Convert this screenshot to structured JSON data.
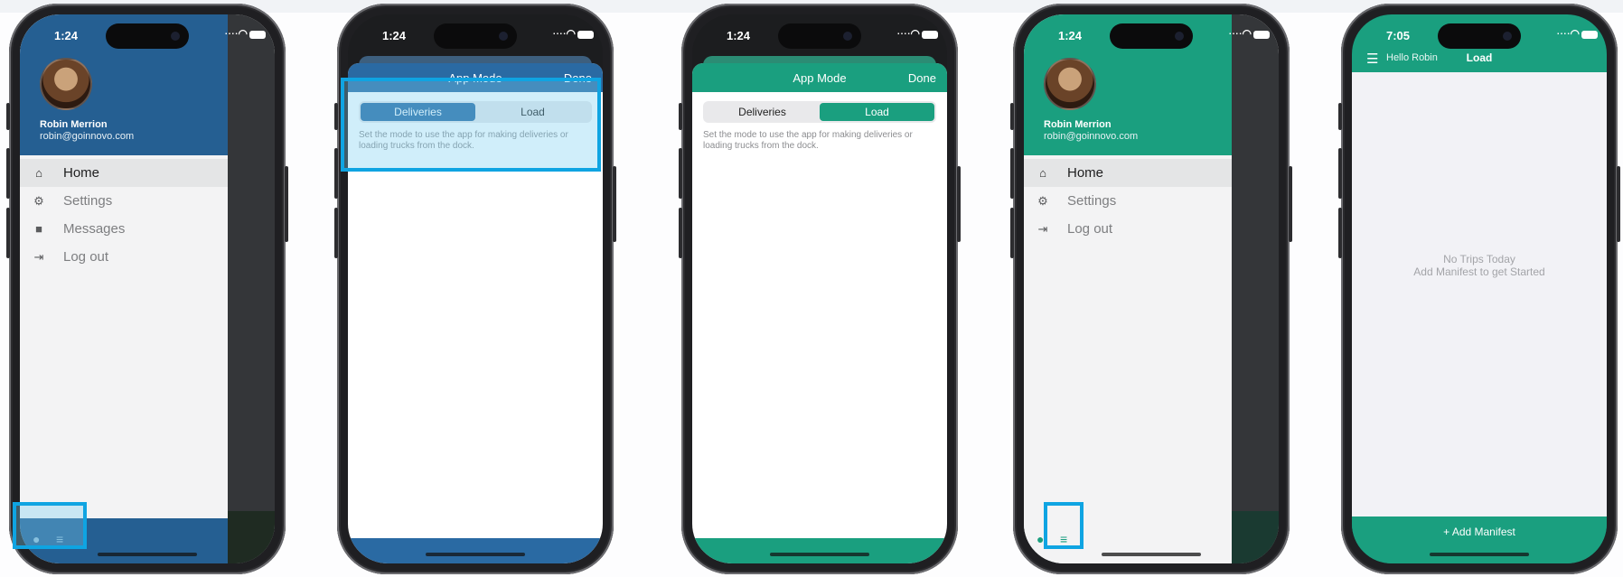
{
  "colors": {
    "blue_header": "#255f92",
    "blue_accent": "#2a6aa3",
    "teal": "#1a9f7f",
    "highlight": "#0fa4e2"
  },
  "phone1": {
    "status_time": "1:24",
    "user_name": "Robin Merrion",
    "user_email": "robin@goinnovo.com",
    "menu": [
      {
        "label": "Home",
        "icon": "home-icon"
      },
      {
        "label": "Settings",
        "icon": "gear-icon"
      },
      {
        "label": "Messages",
        "icon": "chat-bubble-icon"
      },
      {
        "label": "Log out",
        "icon": "logout-icon"
      }
    ],
    "footer_icons": [
      "lightbulb-icon",
      "sliders-icon"
    ]
  },
  "phone2": {
    "status_time": "1:24",
    "title": "App Mode",
    "done": "Done",
    "segments": [
      "Deliveries",
      "Load"
    ],
    "selected": "Deliveries",
    "description": "Set the mode to use the app for making deliveries or loading trucks from the dock."
  },
  "phone3": {
    "status_time": "1:24",
    "title": "App Mode",
    "done": "Done",
    "segments": [
      "Deliveries",
      "Load"
    ],
    "selected": "Load",
    "description": "Set the mode to use the app for making deliveries or loading trucks from the dock."
  },
  "phone4": {
    "status_time": "1:24",
    "user_name": "Robin Merrion",
    "user_email": "robin@goinnovo.com",
    "menu": [
      {
        "label": "Home",
        "icon": "home-icon"
      },
      {
        "label": "Settings",
        "icon": "gear-icon"
      },
      {
        "label": "Log out",
        "icon": "logout-icon"
      }
    ],
    "footer_icons": [
      "lightbulb-icon",
      "sliders-icon"
    ]
  },
  "phone5": {
    "status_time": "7:05",
    "greeting": "Hello Robin",
    "title": "Load",
    "empty_line1": "No Trips Today",
    "empty_line2": "Add Manifest to get Started",
    "add_button": "+ Add Manifest"
  }
}
